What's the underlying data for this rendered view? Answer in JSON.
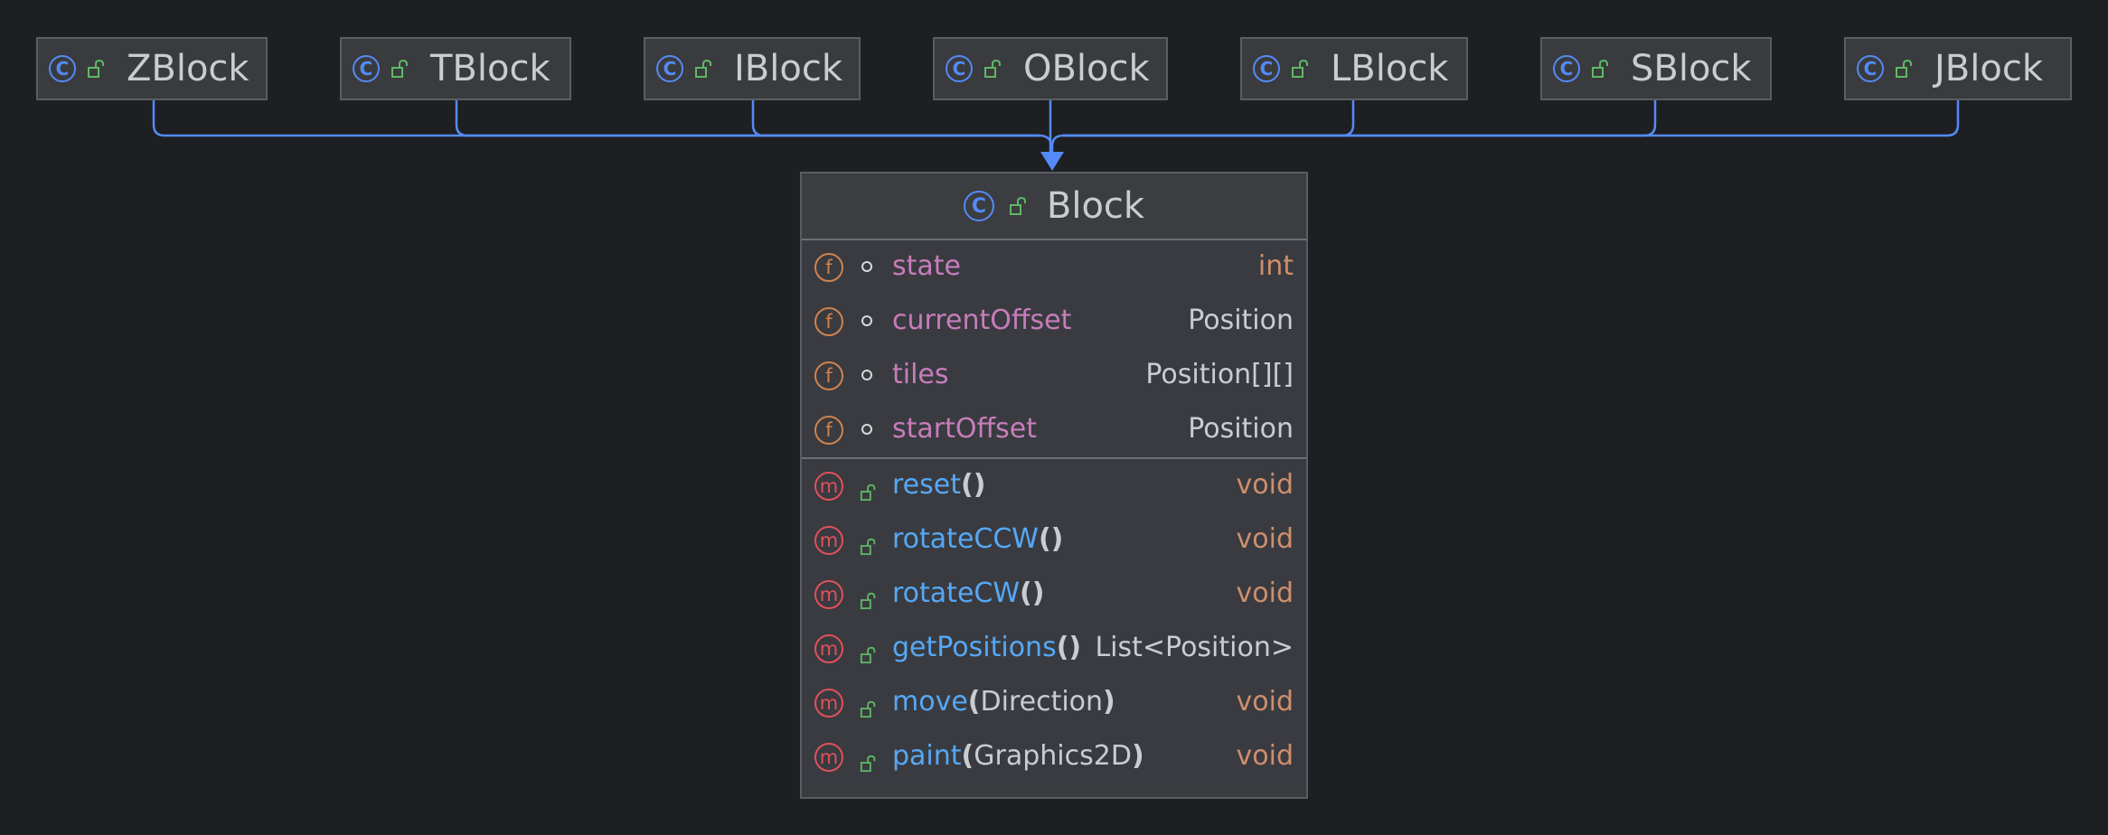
{
  "colors": {
    "background": "#1e1f22",
    "connector": "#548af7",
    "class_icon": "#548af7",
    "field_icon": "#d0834f",
    "method_icon": "#e0515a",
    "public_lock": "#5fb865",
    "field_name": "#c77dbb",
    "method_name": "#56a8f5",
    "primitive_type": "#cf8e6d"
  },
  "icons": {
    "class": "C",
    "field": "f",
    "method": "m"
  },
  "subclasses": [
    {
      "name": "ZBlock"
    },
    {
      "name": "TBlock"
    },
    {
      "name": "IBlock"
    },
    {
      "name": "OBlock"
    },
    {
      "name": "LBlock"
    },
    {
      "name": "SBlock"
    },
    {
      "name": "JBlock"
    }
  ],
  "block": {
    "name": "Block",
    "fields": [
      {
        "name": "state",
        "type": "int"
      },
      {
        "name": "currentOffset",
        "type": "Position"
      },
      {
        "name": "tiles",
        "type": "Position[][]"
      },
      {
        "name": "startOffset",
        "type": "Position"
      }
    ],
    "methods": [
      {
        "name": "reset",
        "open": "(",
        "param": "",
        "close": ")",
        "type": "void"
      },
      {
        "name": "rotateCCW",
        "open": "(",
        "param": "",
        "close": ")",
        "type": "void"
      },
      {
        "name": "rotateCW",
        "open": "(",
        "param": "",
        "close": ")",
        "type": "void"
      },
      {
        "name": "getPositions",
        "open": "(",
        "param": "",
        "close": ")",
        "type": "List<Position>"
      },
      {
        "name": "move",
        "open": "(",
        "param": "Direction",
        "close": ")",
        "type": "void"
      },
      {
        "name": "paint",
        "open": "(",
        "param": "Graphics2D",
        "close": ")",
        "type": "void"
      }
    ]
  }
}
